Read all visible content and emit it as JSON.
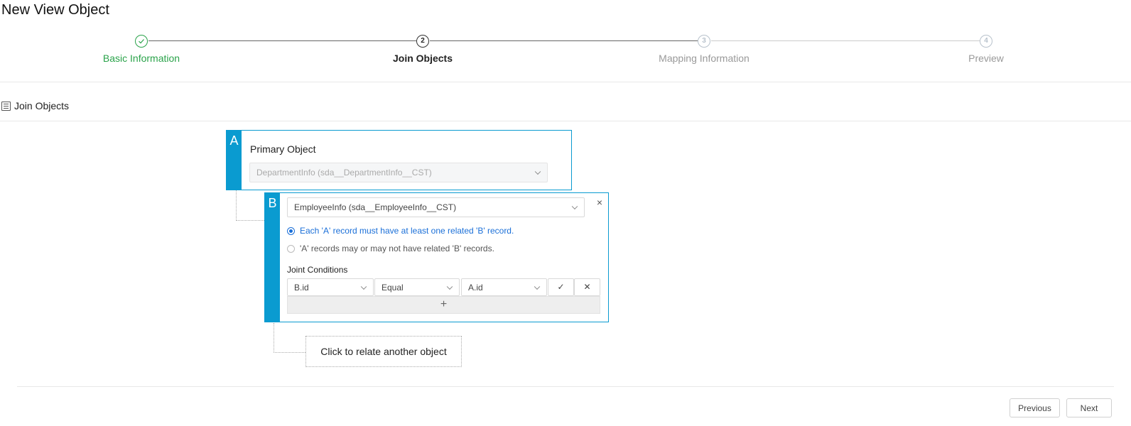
{
  "page": {
    "title": "New View Object"
  },
  "steps": [
    {
      "number": "",
      "label": "Basic Information",
      "state": "done"
    },
    {
      "number": "2",
      "label": "Join Objects",
      "state": "active"
    },
    {
      "number": "3",
      "label": "Mapping Information",
      "state": "future"
    },
    {
      "number": "4",
      "label": "Preview",
      "state": "future"
    }
  ],
  "section": {
    "title": "Join Objects"
  },
  "object_a": {
    "letter": "A",
    "label": "Primary Object",
    "selected": "DepartmentInfo (sda__DepartmentInfo__CST)"
  },
  "object_b": {
    "letter": "B",
    "selected": "EmployeeInfo (sda__EmployeeInfo__CST)",
    "close": "×",
    "options": [
      {
        "label": "Each 'A' record must have at least one related 'B' record.",
        "checked": true
      },
      {
        "label": "'A' records may or may not have related 'B' records.",
        "checked": false
      }
    ],
    "conditions_label": "Joint Conditions",
    "condition": {
      "left": "B.id",
      "operator": "Equal",
      "right": "A.id",
      "confirm": "✓",
      "remove": "✕"
    },
    "add": "+"
  },
  "relate": {
    "label": "Click to relate another object"
  },
  "footer": {
    "previous": "Previous",
    "next": "Next"
  },
  "colors": {
    "accent": "#0a9bd0",
    "done": "#2aa34a",
    "link": "#1a6fd8"
  }
}
